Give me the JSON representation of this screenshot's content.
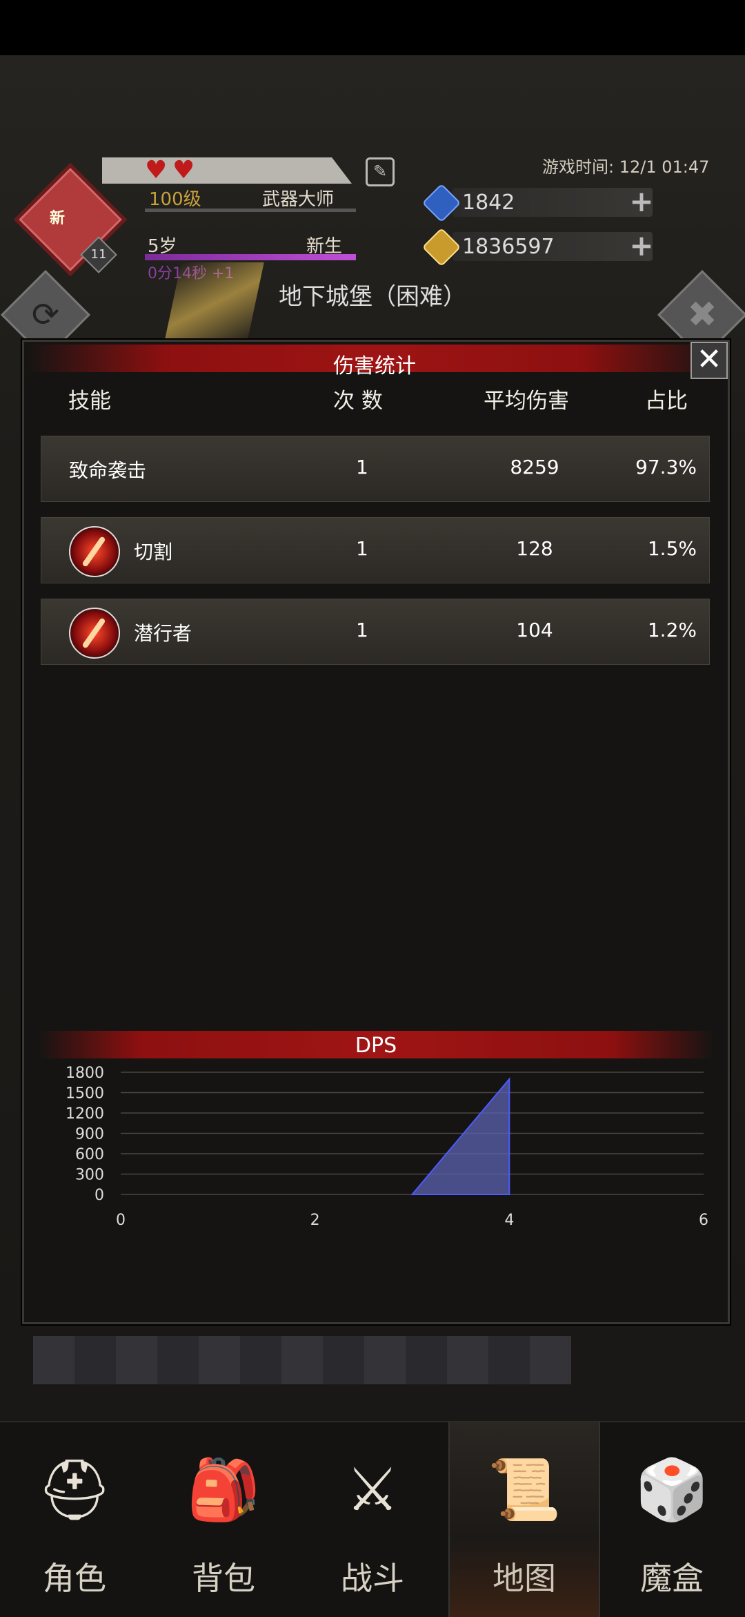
{
  "header": {
    "new_tag": "新",
    "level_badge": "11",
    "level": "100级",
    "title": "武器大师",
    "age": "5岁",
    "state": "新生",
    "timer": "0分14秒 +1",
    "game_time": "游戏时间: 12/1 01:47",
    "gems": "1842",
    "gold": "1836597",
    "dungeon": "地下城堡（困难）"
  },
  "dialog": {
    "title": "伤害统计",
    "columns": {
      "skill": "技能",
      "count": "次 数",
      "avg": "平均伤害",
      "ratio": "占比"
    },
    "rows": [
      {
        "skill": "致命袭击",
        "count": "1",
        "avg": "8259",
        "ratio": "97.3%"
      },
      {
        "skill": "切割",
        "count": "1",
        "avg": "128",
        "ratio": "1.5%"
      },
      {
        "skill": "潜行者",
        "count": "1",
        "avg": "104",
        "ratio": "1.2%"
      }
    ],
    "dps_title": "DPS"
  },
  "chart_data": {
    "type": "area",
    "title": "DPS",
    "x": [
      3,
      4
    ],
    "y": [
      0,
      1700
    ],
    "xlim": [
      0,
      6
    ],
    "ylim": [
      0,
      1800
    ],
    "xticks": [
      0,
      2,
      4,
      6
    ],
    "yticks": [
      0,
      300,
      600,
      900,
      1200,
      1500,
      1800
    ],
    "grid": true,
    "fill_color": "#5b62b0",
    "line_color": "#4a5bff"
  },
  "nav": [
    {
      "label": "角色",
      "icon": "helmet-icon"
    },
    {
      "label": "背包",
      "icon": "backpack-icon"
    },
    {
      "label": "战斗",
      "icon": "sword-shield-icon"
    },
    {
      "label": "地图",
      "icon": "map-scroll-icon"
    },
    {
      "label": "魔盒",
      "icon": "magic-box-icon"
    }
  ],
  "colors": {
    "accent_red": "#9e1414",
    "gold_text": "#c7a23c",
    "purple_bar": "#c14fd6"
  }
}
